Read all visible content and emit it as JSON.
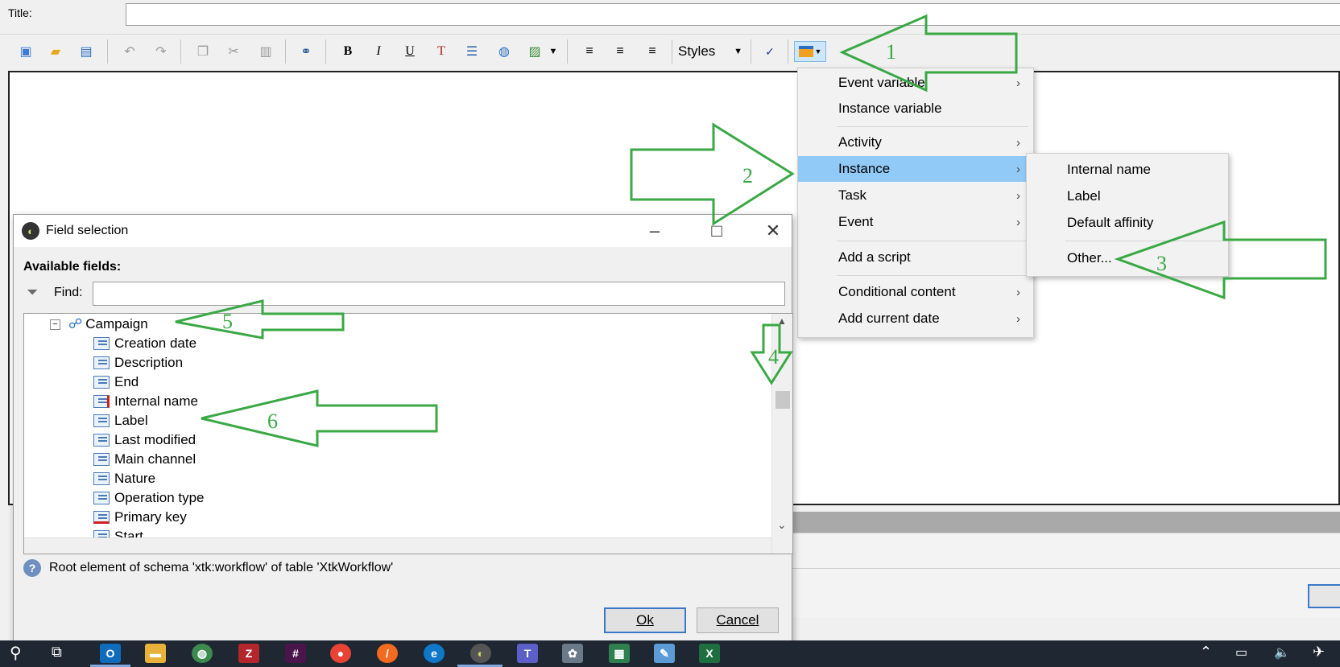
{
  "title_label": "Title:",
  "toolbar": {
    "styles_label": "Styles"
  },
  "menu_main": [
    {
      "label": "Event variable",
      "sub": true
    },
    {
      "label": "Instance variable",
      "sub": false
    },
    {
      "label": "Activity",
      "sub": true
    },
    {
      "label": "Instance",
      "sub": true
    },
    {
      "label": "Task",
      "sub": true
    },
    {
      "label": "Event",
      "sub": true
    },
    {
      "label": "Add a script",
      "sub": false
    },
    {
      "label": "Conditional content",
      "sub": true
    },
    {
      "label": "Add current date",
      "sub": true
    }
  ],
  "menu_sub": [
    "Internal name",
    "Label",
    "Default affinity",
    "Other..."
  ],
  "dialog": {
    "title": "Field selection",
    "available_label": "Available fields:",
    "find_label": "Find:",
    "find_value": "",
    "root_node": "Campaign",
    "fields": [
      "Creation date",
      "Description",
      "End",
      "Internal name",
      "Label",
      "Last modified",
      "Main channel",
      "Nature",
      "Operation type",
      "Primary key",
      "Start"
    ],
    "status": "Root element of schema 'xtk:workflow' of table 'XtkWorkflow'",
    "ok_label": "Ok",
    "cancel_label": "Cancel"
  },
  "annotations": [
    "1",
    "2",
    "3",
    "4",
    "5",
    "6"
  ],
  "colors": {
    "highlight": "#91c9f7",
    "annotation": "#3aa845",
    "taskbar": "#1f2732"
  }
}
